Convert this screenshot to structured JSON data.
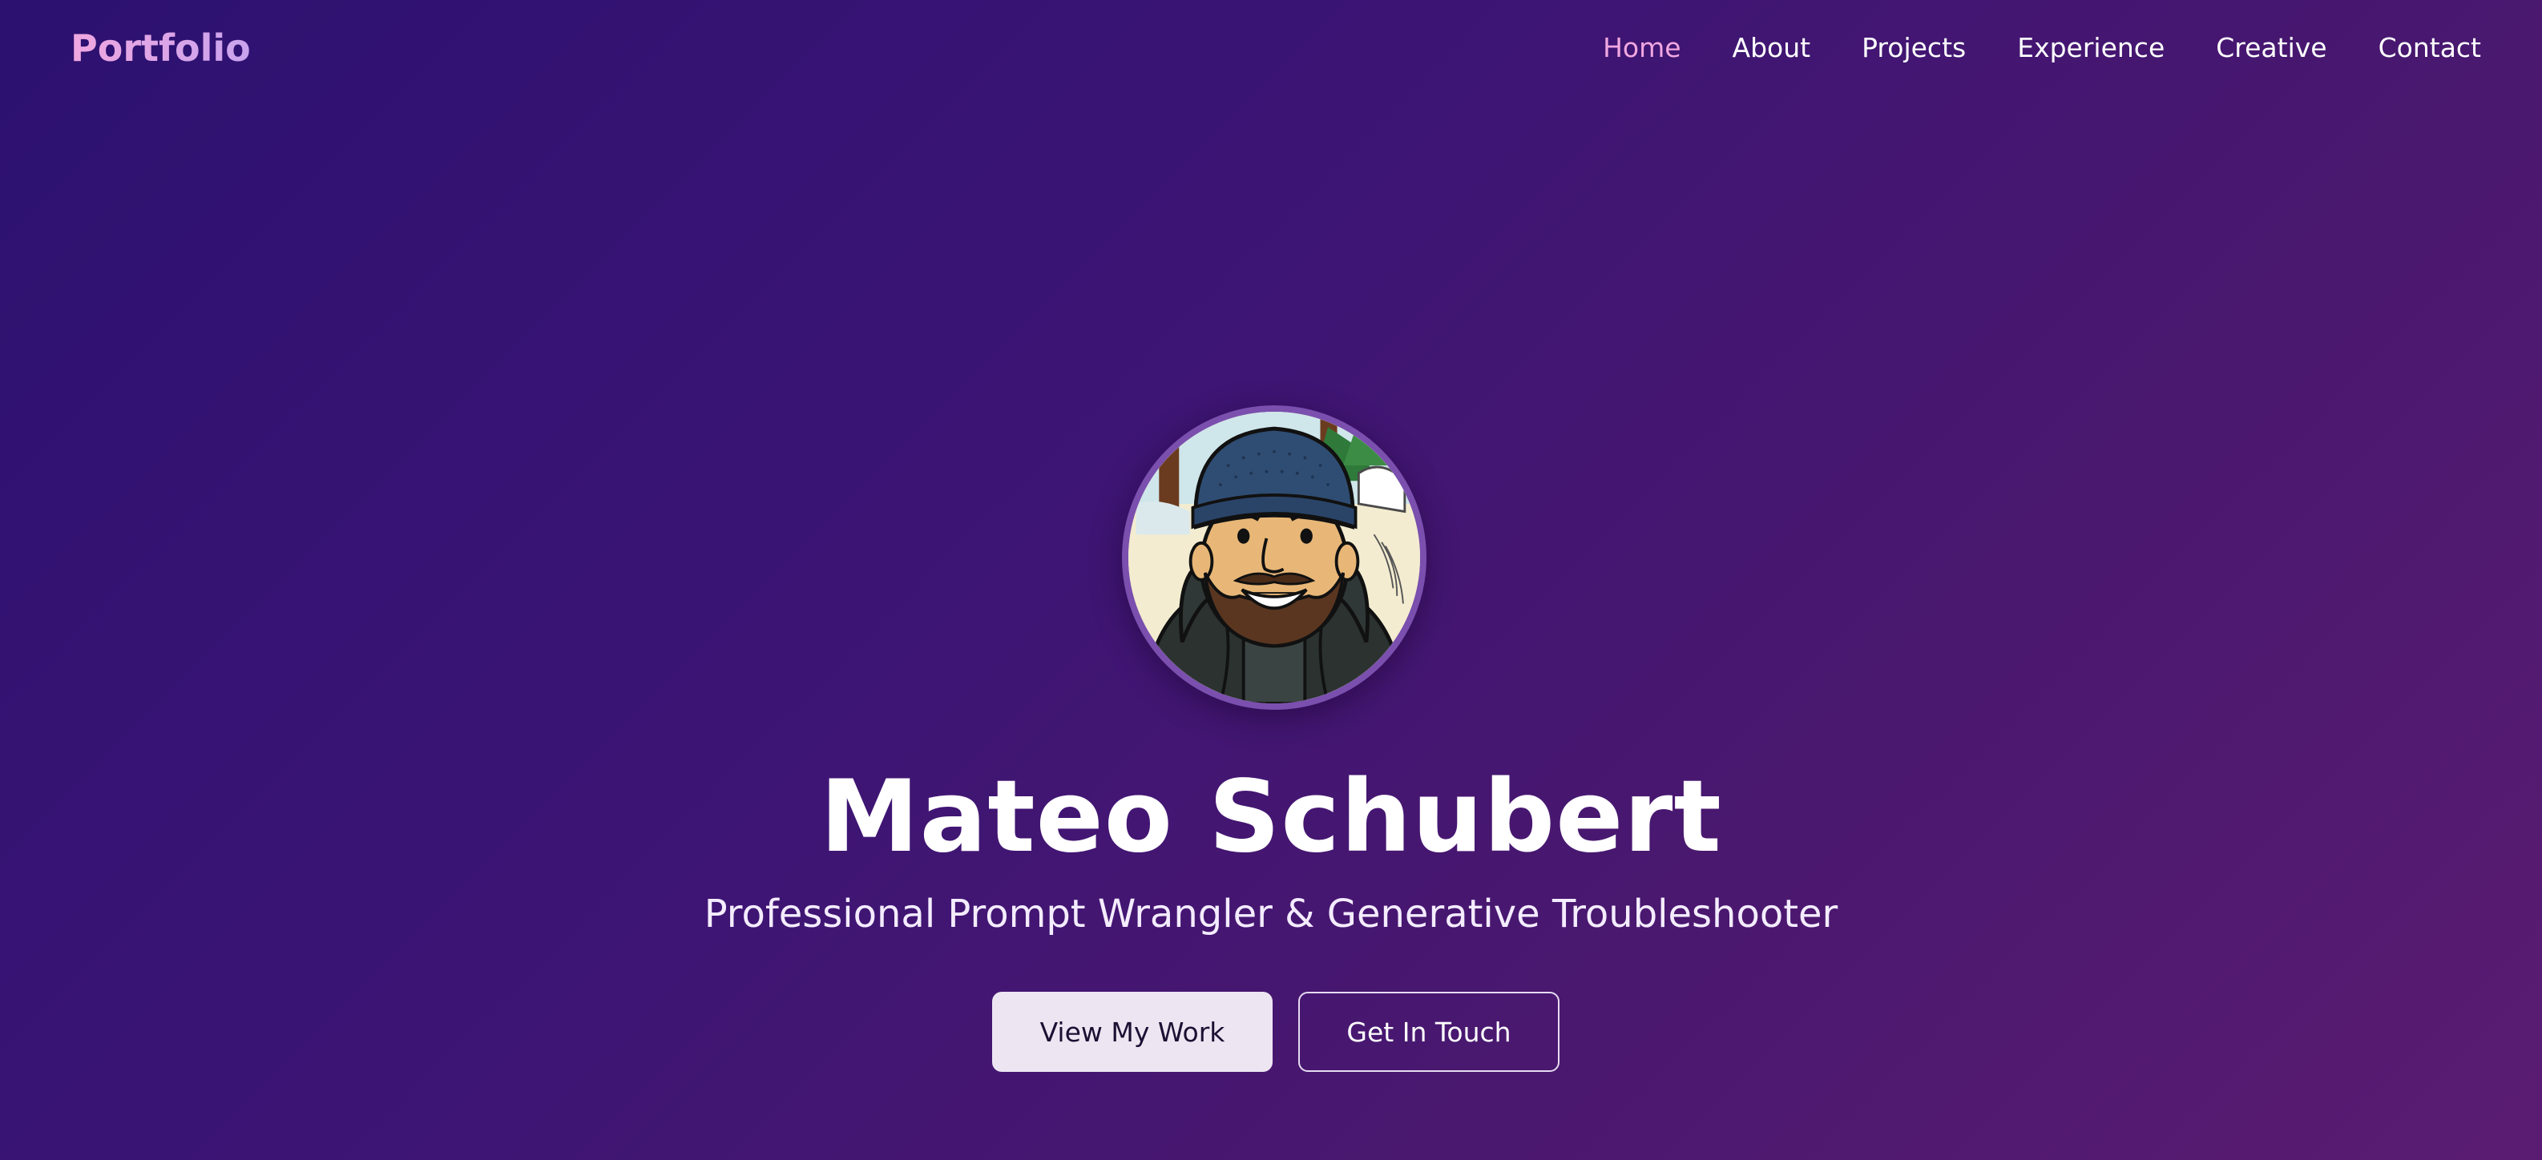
{
  "header": {
    "logo": "Portfolio",
    "nav": [
      {
        "label": "Home",
        "active": true
      },
      {
        "label": "About",
        "active": false
      },
      {
        "label": "Projects",
        "active": false
      },
      {
        "label": "Experience",
        "active": false
      },
      {
        "label": "Creative",
        "active": false
      },
      {
        "label": "Contact",
        "active": false
      }
    ]
  },
  "hero": {
    "avatar_icon": "cartoon-portrait",
    "name": "Mateo Schubert",
    "tagline": "Professional Prompt Wrangler & Generative Troubleshooter",
    "primary_button": "View My Work",
    "secondary_button": "Get In Touch"
  },
  "colors": {
    "background_start": "#2c1170",
    "background_end": "#5a1c72",
    "accent": "#f0a7e0",
    "avatar_border": "#7a4fae",
    "primary_button_bg": "#ede6f2"
  }
}
